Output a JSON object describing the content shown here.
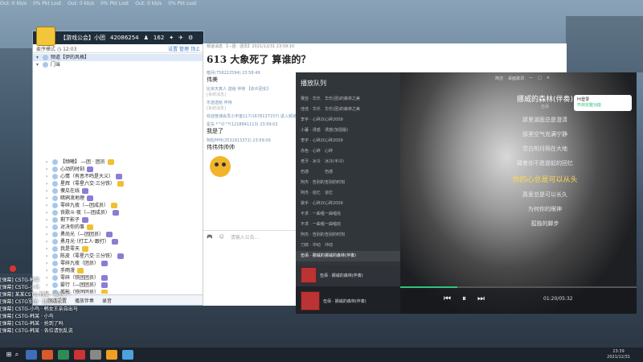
{
  "overlay": {
    "stats": [
      "Out: 0 kb/s",
      "0% Pkt Lost",
      "Out: 0 kb/s",
      "0% Pkt Lost",
      "Out: 0 kb/s",
      "0% Pkt Lost"
    ]
  },
  "voice_app": {
    "room_label": "【游戏公会】小团",
    "room_id": "42086254",
    "online": "162",
    "mode": "麦序模式",
    "time": "12:03",
    "links": [
      "设置",
      "管理",
      "顶上"
    ],
    "channels": [
      {
        "name": "频道【伊的风格】",
        "highlight": true
      },
      {
        "name": "门当"
      }
    ],
    "members": [
      "【频曦】 —团 · 团员",
      "心动的时刻",
      "心情（有恶不鸣是大义）",
      "星辉（零星六交·三分铁）",
      "傻瓜在线",
      "暗鸦浪地理",
      "零碎九夜（—团成员）",
      "丧歌斗·夜（—团成员）",
      "剩下影子",
      "对决你的事",
      "勇尚光（—团团员）",
      "勇月光·（打工人·跟打）",
      "我是零天",
      "陈皮（零星六交·三分铁）",
      "零碎九夜（团员）",
      "手雨漫",
      "零碎（铁团团员）",
      "雾行（—团团员）",
      "孤影（铁团团员）",
      "魅魔（—团团员）"
    ],
    "bottom": [
      "频道设置",
      "播放伴奏",
      "录音"
    ]
  },
  "chat": {
    "header": "频道消息 【—团 · 团员】2021/12/31 23:59:10",
    "title": "613 大象死了 算谁的？",
    "messages": [
      {
        "meta": "暗月(758222594) 23:58:49",
        "text": "伟美"
      },
      {
        "meta": "比米天真人 送给 伴侍 【赤炎团长】",
        "sys": "[系统消息]"
      },
      {
        "meta": "乐途送给 伴侍",
        "sys": "[系统消息]"
      },
      {
        "meta": "欢迎普通会员小宇宙117(1678137157) 进入频道",
        "gift": ""
      },
      {
        "meta": "星矢 *^O^*(1218841113) 23:59:02",
        "text": "我是了"
      },
      {
        "meta": "阿彪咔咔(2531913372) 23:59:09",
        "text": "伟伟伟帅帅"
      }
    ],
    "input_placeholder": "请输入公告…"
  },
  "player": {
    "queue_title": "播放队列",
    "queue": [
      [
        "赛亚 · 华乐",
        "华乐(团)的森林之美"
      ],
      [
        "佳佳 · 华乐",
        "华乐(团)的森林之美"
      ],
      [
        "李宇 · 心碎2009",
        "心碎2009"
      ],
      [
        "小暮 · 诱惑",
        "诱惑(加强版)"
      ],
      [
        "李宇 · 心碎2009",
        "心碎2009"
      ],
      [
        "赤色 · 心碎",
        "心碎"
      ],
      [
        "老牙 · 冰冷",
        "冰冷(半冷)"
      ],
      [
        "伤感",
        "伤感"
      ],
      [
        "阿杰 · 告别的时刻",
        "告别的时刻"
      ],
      [
        "阿杰 · 追忆",
        "追忆"
      ],
      [
        "歌手 · 心碎2009",
        "心碎2009"
      ],
      [
        "不求 · 一曲唱完",
        "一曲唱完"
      ],
      [
        "不求 · 一曲唱完",
        "一曲唱完"
      ],
      [
        "阿杰 · 告别的时刻",
        "告别的时刻"
      ],
      [
        "刀郎 · 冲动",
        "冲动"
      ],
      [
        "伍佰 · 挪威的森林",
        "挪威的森林(伴奏)"
      ]
    ],
    "song_title": "挪威的森林(伴奏)",
    "song_artist": "伍佰",
    "lyrics": [
      "那里湖面总是澄清",
      "那里空气充满宁静",
      "雪白明月照在大地",
      "藏着你不愿提起的回忆",
      "你的心总是可以从头",
      "真爱总是可以长久",
      "为何你的眼神",
      "孤独的脚步"
    ],
    "current_lyric_index": 4,
    "login_text": "Hi登录",
    "login_sub": "开启完整功能",
    "top_buttons": [
      "简洁",
      "桌面歌词",
      "—",
      "□",
      "×"
    ],
    "np_artist": "伍佰 · 挪威的森林(伴奏)",
    "time": "01:20/05:32",
    "progress": 0.24
  },
  "overlay_chat": [
    "[弹幕] CSTG-韩某",
    "[弹幕] CSTG-小鸟",
    "[弹幕] 某某CSTG-韩某 · 被抢了？",
    "[弹幕] CSTG军团 · 我的大哥",
    "[弹幕] CSTG-小鸟 · 韩女王亲自出马",
    "[弹幕] CSTG-韩某 · 小鸟",
    "[弹幕] CSTG-韩某 · 抢到了吗",
    "[弹幕] CSTG-韩某 · 各位请别乱说"
  ],
  "taskbar": {
    "time": "23:39",
    "date": "2021/12/31"
  },
  "colors": {
    "accent": "#31c27c",
    "lyric": "#ffd84a",
    "app_dark": "#1f2d3a"
  }
}
